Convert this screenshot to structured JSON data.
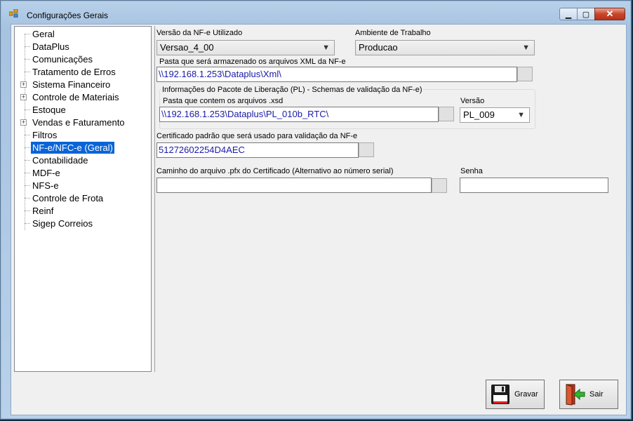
{
  "window": {
    "title": "Configurações Gerais"
  },
  "tree": {
    "items": [
      {
        "label": "Geral",
        "expandable": false
      },
      {
        "label": "DataPlus",
        "expandable": false
      },
      {
        "label": "Comunicações",
        "expandable": false
      },
      {
        "label": "Tratamento de Erros",
        "expandable": false
      },
      {
        "label": "Sistema Financeiro",
        "expandable": true
      },
      {
        "label": "Controle de Materiais",
        "expandable": true
      },
      {
        "label": "Estoque",
        "expandable": false
      },
      {
        "label": "Vendas e Faturamento",
        "expandable": true
      },
      {
        "label": "Filtros",
        "expandable": false
      },
      {
        "label": "NF-e/NFC-e (Geral)",
        "expandable": false,
        "selected": true
      },
      {
        "label": "Contabilidade",
        "expandable": false
      },
      {
        "label": "MDF-e",
        "expandable": false
      },
      {
        "label": "NFS-e",
        "expandable": false
      },
      {
        "label": "Controle de Frota",
        "expandable": false
      },
      {
        "label": "Reinf",
        "expandable": false
      },
      {
        "label": "Sigep Correios",
        "expandable": false
      }
    ]
  },
  "form": {
    "versao_label": "Versão da NF-e Utilizado",
    "versao_value": "Versao_4_00",
    "ambiente_label": "Ambiente de Trabalho",
    "ambiente_value": "Producao",
    "pasta_xml_label": "Pasta que será armazenado os arquivos XML da NF-e",
    "pasta_xml_value": "\\\\192.168.1.253\\Dataplus\\Xml\\",
    "pl_group_label": "Informações do Pacote de Liberação (PL) - Schemas de validação da NF-e)",
    "pasta_xsd_label": "Pasta que contem os arquivos .xsd",
    "pasta_xsd_value": "\\\\192.168.1.253\\Dataplus\\PL_010b_RTC\\",
    "pl_versao_label": "Versão",
    "pl_versao_value": "PL_009",
    "certificado_label": "Certificado padrão que será usado para validação da NF-e",
    "certificado_value": "51272602254D4AEC",
    "pfx_label": "Caminho do arquivo .pfx do Certificado (Alternativo ao número serial)",
    "pfx_value": "",
    "senha_label": "Senha",
    "senha_value": ""
  },
  "buttons": {
    "gravar": "Gravar",
    "sair": "Sair"
  },
  "colors": {
    "selection": "#0a64d6",
    "path_text": "#1a1aa8"
  }
}
